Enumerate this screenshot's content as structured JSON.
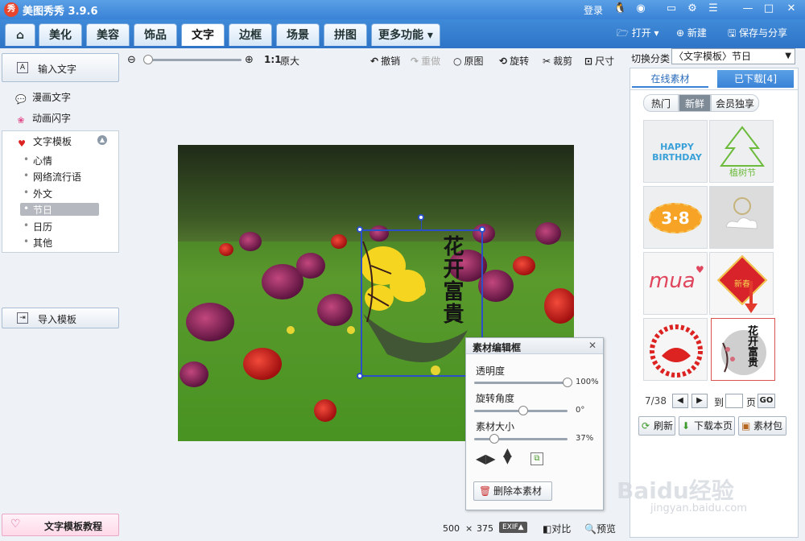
{
  "app": {
    "title": "美图秀秀 3.9.6",
    "logo_text": "秀"
  },
  "titlebar": {
    "login": "登录"
  },
  "tabs": {
    "home": "⌂",
    "items": [
      "美化",
      "美容",
      "饰品",
      "文字",
      "边框",
      "场景",
      "拼图",
      "更多功能"
    ],
    "active": "文字"
  },
  "top_right": {
    "open": "打开",
    "new": "新建",
    "save_share": "保存与分享"
  },
  "left": {
    "input_text": "输入文字",
    "comic_text": "漫画文字",
    "anim_text": "动画闪字",
    "template": {
      "title": "文字模板",
      "items": [
        "心情",
        "网络流行语",
        "外文",
        "节日",
        "日历",
        "其他"
      ],
      "selected": "节日"
    },
    "import_template": "导入模板",
    "tutorial": "文字模板教程"
  },
  "toolbar": {
    "actual_size": "1:1",
    "original_size": "原大",
    "undo": "撤销",
    "redo": "重做",
    "reset": "原图",
    "rotate": "旋转",
    "crop": "裁剪",
    "resize": "尺寸",
    "zoom_value": 0
  },
  "editor": {
    "title": "素材编辑框",
    "opacity_label": "透明度",
    "opacity": "100%",
    "opacity_value": 1.0,
    "rotate_label": "旋转角度",
    "rotate": "0°",
    "rotate_value": 0.5,
    "size_label": "素材大小",
    "size": "37%",
    "size_value": 0.17,
    "delete": "删除本素材"
  },
  "status": {
    "width": "500",
    "x": "×",
    "height": "375",
    "exif": "EXIF▲",
    "compare": "对比",
    "preview": "预览"
  },
  "right": {
    "switch_label": "切换分类",
    "category": "〈文字模板〉节日",
    "tab_online": "在线素材",
    "tab_downloaded": "已下载[4]",
    "chips": [
      "热门",
      "新鲜",
      "会员独享"
    ],
    "chip_active": "新鲜",
    "thumb_text": {
      "birthday": "HAPPY BIRTHDAY",
      "tree": "植树节",
      "day38": "3·8",
      "mua": "mua",
      "spring": "新春",
      "sticker": "花开富贵"
    },
    "page": "7/38",
    "goto": "到",
    "page_unit": "页",
    "go": "GO",
    "refresh": "刷新",
    "download_page": "下载本页",
    "material_pack": "素材包"
  },
  "overlay": {
    "poem": "花开富貴"
  },
  "watermark": {
    "brand": "Baidu经验",
    "url": "jingyan.baidu.com"
  }
}
